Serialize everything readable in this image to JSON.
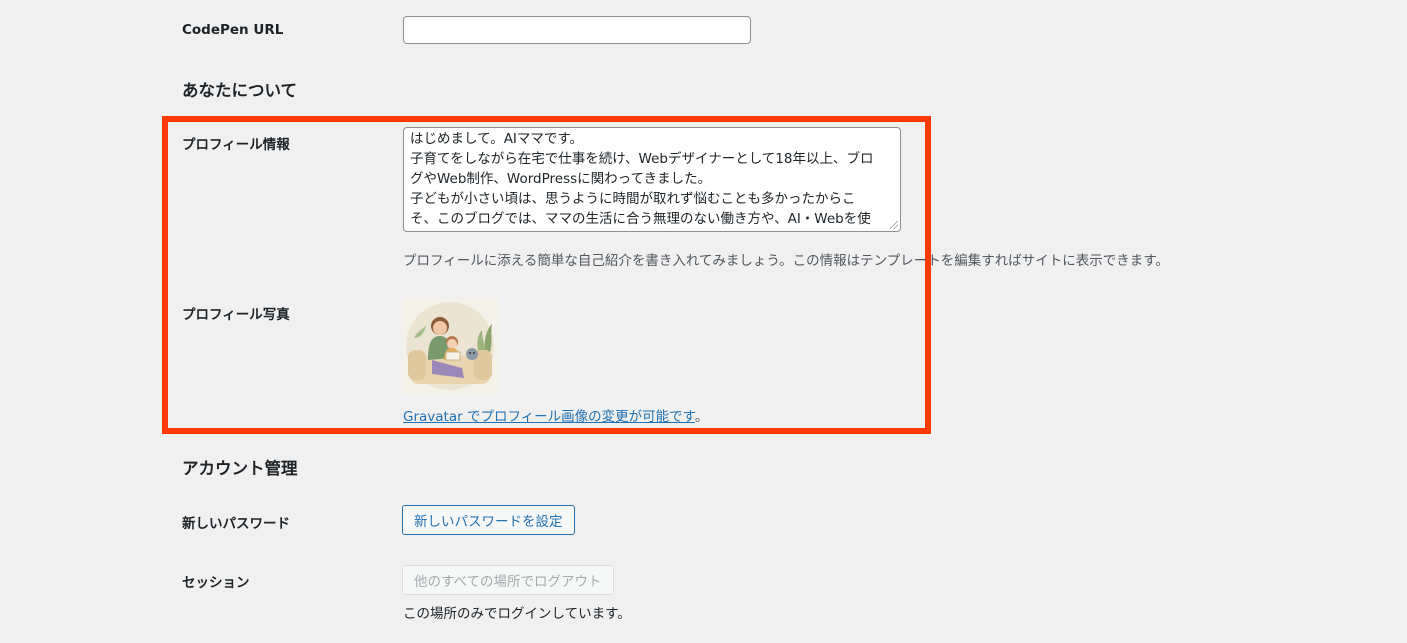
{
  "codepen": {
    "label": "CodePen URL",
    "value": ""
  },
  "about_section": {
    "title": "あなたについて"
  },
  "profile_info": {
    "label": "プロフィール情報",
    "lines": [
      "はじめまして。AIママです。",
      "子育てをしながら在宅で仕事を続け、Webデザイナーとして18年以上、ブロ",
      "グやWeb制作、WordPressに関わってきました。",
      "子どもが小さい頃は、思うように時間が取れず悩むことも多かったからこ",
      "そ、このブログでは、ママの生活に合う無理のない働き方や、AI・Webを使"
    ],
    "description": "プロフィールに添える簡単な自己紹介を書き入れてみましょう。この情報はテンプレートを編集すればサイトに表示できます。"
  },
  "profile_photo": {
    "label": "プロフィール写真",
    "gravatar_link": "Gravatar でプロフィール画像の変更が可能です",
    "gravatar_suffix": "。"
  },
  "account_section": {
    "title": "アカウント管理"
  },
  "new_password": {
    "label": "新しいパスワード",
    "button": "新しいパスワードを設定"
  },
  "session": {
    "label": "セッション",
    "button": "他のすべての場所でログアウト",
    "note": "この場所のみでログインしています。"
  },
  "colors": {
    "highlight": "#ff3a00",
    "link": "#2271b1",
    "background": "#f0f0f1"
  }
}
